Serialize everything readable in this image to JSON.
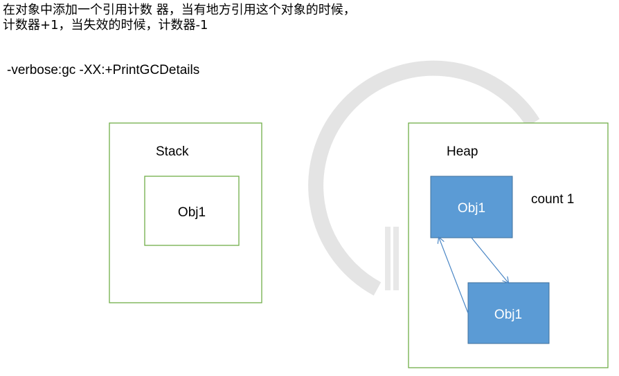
{
  "description": {
    "line1": "在对象中添加一个引用计数 器，当有地方引用这个对象的时候，",
    "line2": "计数器+1，当失效的时候，计数器-1"
  },
  "jvm_flags": "-verbose:gc -XX:+PrintGCDetails",
  "stack": {
    "title": "Stack",
    "object_label": "Obj1"
  },
  "heap": {
    "title": "Heap",
    "object_top_label": "Obj1",
    "object_bottom_label": "Obj1",
    "count_label": "count 1"
  },
  "colors": {
    "frame_border": "#70ad47",
    "object_fill": "#5b9bd5",
    "object_border": "#41719c",
    "arrow": "#4a86c5",
    "watermark": "#e4e4e4"
  }
}
